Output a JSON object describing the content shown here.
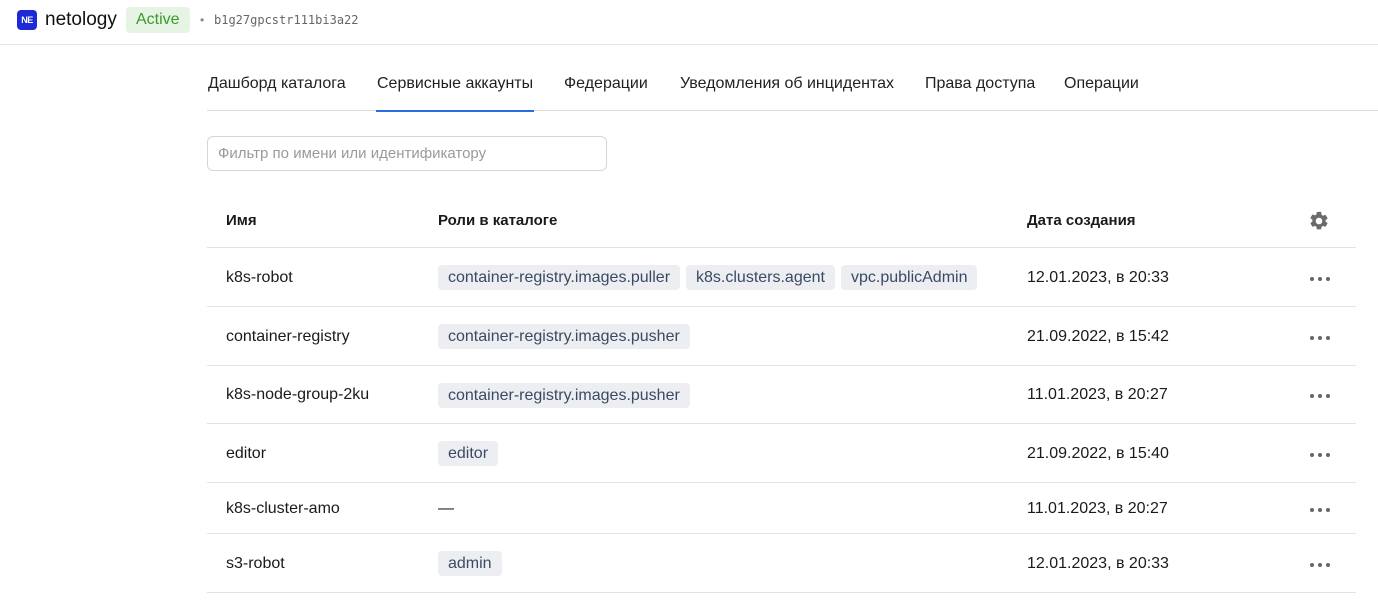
{
  "header": {
    "logo_text": "NE",
    "app_name": "netology",
    "status": "Active",
    "separator": "•",
    "folder_id": "b1g27gpcstr111bi3a22"
  },
  "tabs": [
    {
      "label": "Дашборд каталога",
      "active": false
    },
    {
      "label": "Сервисные аккаунты",
      "active": true
    },
    {
      "label": "Федерации",
      "active": false
    },
    {
      "label": "Уведомления об инцидентах",
      "active": false
    },
    {
      "label": "Права доступа",
      "active": false
    },
    {
      "label": "Операции",
      "active": false
    }
  ],
  "filter": {
    "placeholder": "Фильтр по имени или идентификатору",
    "value": ""
  },
  "table": {
    "columns": {
      "name": "Имя",
      "roles": "Роли в каталоге",
      "created": "Дата создания"
    },
    "settings_icon": "gear-icon",
    "row_menu_icon": "more-horizontal-icon",
    "rows": [
      {
        "name": "k8s-robot",
        "roles": [
          "container-registry.images.puller",
          "k8s.clusters.agent",
          "vpc.publicAdmin"
        ],
        "roles_empty": "",
        "created": "12.01.2023, в 20:33"
      },
      {
        "name": "container-registry",
        "roles": [
          "container-registry.images.pusher"
        ],
        "roles_empty": "",
        "created": "21.09.2022, в 15:42"
      },
      {
        "name": "k8s-node-group-2ku",
        "roles": [
          "container-registry.images.pusher"
        ],
        "roles_empty": "",
        "created": "11.01.2023, в 20:27"
      },
      {
        "name": "editor",
        "roles": [
          "editor"
        ],
        "roles_empty": "",
        "created": "21.09.2022, в 15:40"
      },
      {
        "name": "k8s-cluster-amo",
        "roles": [],
        "roles_empty": "—",
        "created": "11.01.2023, в 20:27"
      },
      {
        "name": "s3-robot",
        "roles": [
          "admin"
        ],
        "roles_empty": "",
        "created": "12.01.2023, в 20:33"
      }
    ]
  },
  "colors": {
    "accent": "#2b6ce0",
    "logo": "#1d2ad6",
    "status_bg": "#e6f4e3",
    "status_text": "#3a9a2b",
    "role_bg": "#eceef2"
  }
}
